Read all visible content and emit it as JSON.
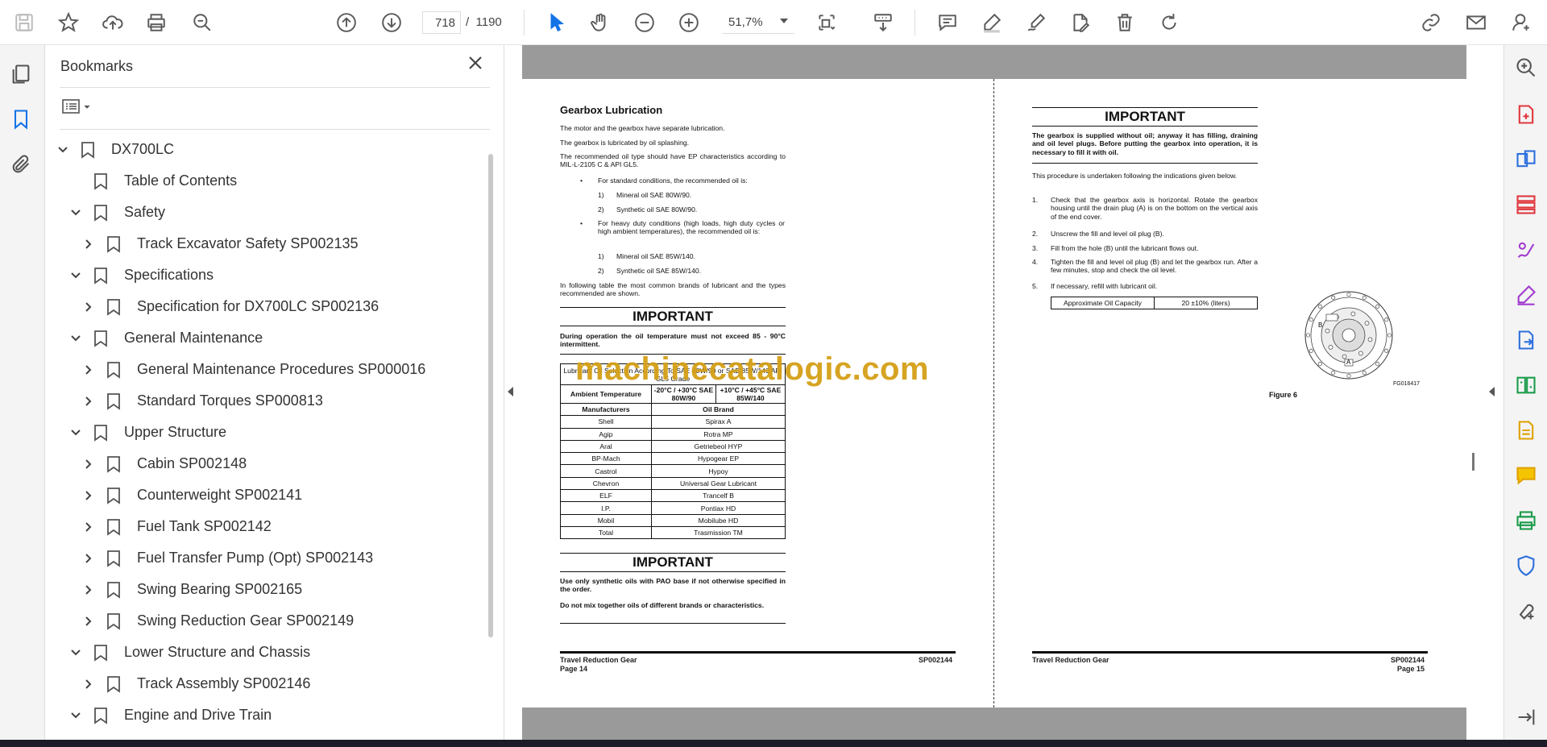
{
  "toolbar": {
    "current_page": "718",
    "separator": "/",
    "total_pages": "1190",
    "zoom": "51,7%"
  },
  "bookmarks": {
    "title": "Bookmarks",
    "items": [
      {
        "label": "DX700LC",
        "level": 0,
        "state": "expanded"
      },
      {
        "label": "Table of Contents",
        "level": 1,
        "state": "leaf"
      },
      {
        "label": "Safety",
        "level": 1,
        "state": "expanded"
      },
      {
        "label": "Track Excavator Safety SP002135",
        "level": 2,
        "state": "collapsed"
      },
      {
        "label": "Specifications",
        "level": 1,
        "state": "expanded"
      },
      {
        "label": "Specification for DX700LC SP002136",
        "level": 2,
        "state": "collapsed"
      },
      {
        "label": "General Maintenance",
        "level": 1,
        "state": "expanded"
      },
      {
        "label": "General Maintenance Procedures SP000016",
        "level": 2,
        "state": "collapsed"
      },
      {
        "label": "Standard Torques SP000813",
        "level": 2,
        "state": "collapsed"
      },
      {
        "label": "Upper Structure",
        "level": 1,
        "state": "expanded"
      },
      {
        "label": "Cabin SP002148",
        "level": 2,
        "state": "collapsed"
      },
      {
        "label": "Counterweight SP002141",
        "level": 2,
        "state": "collapsed"
      },
      {
        "label": "Fuel Tank SP002142",
        "level": 2,
        "state": "collapsed"
      },
      {
        "label": "Fuel Transfer Pump (Opt) SP002143",
        "level": 2,
        "state": "collapsed"
      },
      {
        "label": "Swing Bearing SP002165",
        "level": 2,
        "state": "collapsed"
      },
      {
        "label": "Swing Reduction Gear SP002149",
        "level": 2,
        "state": "collapsed"
      },
      {
        "label": "Lower Structure and Chassis",
        "level": 1,
        "state": "expanded"
      },
      {
        "label": "Track Assembly SP002146",
        "level": 2,
        "state": "collapsed"
      },
      {
        "label": "Engine and Drive Train",
        "level": 1,
        "state": "expanded"
      }
    ]
  },
  "left_page": {
    "heading": "Gearbox Lubrication",
    "p1": "The motor and the gearbox have separate lubrication.",
    "p2": "The gearbox is lubricated by oil splashing.",
    "p3": "The recommended oil type should have EP characteristics according to MIL-L-2105 C & API GL5.",
    "bullet1": "For standard conditions, the recommended oil is:",
    "b1_items": [
      "Mineral oil SAE 80W/90.",
      "Synthetic oil SAE 80W/90."
    ],
    "bullet2": "For heavy duty conditions (high loads, high duty cycles or high ambient temperatures), the recommended oil is:",
    "b2_items": [
      "Mineral oil SAE 85W/140.",
      "Synthetic oil SAE 85W/140."
    ],
    "p4": "In following table the most common brands of lubricant and the types recommended are shown.",
    "important1_title": "IMPORTANT",
    "important1_text": "During operation the oil temperature must not exceed 85 - 90°C intermittent.",
    "table_head": "Lubricant Oil Selection According To SAE 80W/90 or SAE 85W/140 API GL5 Grade",
    "col_amb": "Ambient Temperature",
    "col_1": "-20°C / +30°C SAE 80W/90",
    "col_2": "+10°C / +45°C SAE 85W/140",
    "col_man": "Manufacturers",
    "col_brand": "Oil Brand",
    "rows": [
      [
        "Shell",
        "Spirax A"
      ],
      [
        "Agip",
        "Rotra MP"
      ],
      [
        "Aral",
        "Getriebeol HYP"
      ],
      [
        "BP-Mach",
        "Hypogear EP"
      ],
      [
        "Castrol",
        "Hypoy"
      ],
      [
        "Chevron",
        "Universal Gear Lubricant"
      ],
      [
        "ELF",
        "Trancelf B"
      ],
      [
        "I.P.",
        "Pontiax HD"
      ],
      [
        "Mobil",
        "Mobilube HD"
      ],
      [
        "Total",
        "Trasmission TM"
      ]
    ],
    "important2_title": "IMPORTANT",
    "important2_text1": "Use only synthetic oils with PAO base if not otherwise specified in the order.",
    "important2_text2": "Do not mix together oils of different brands or characteristics.",
    "footer_left": "Travel Reduction Gear",
    "footer_page": "Page 14",
    "footer_code": "SP002144"
  },
  "right_page": {
    "important_title": "IMPORTANT",
    "important_text": "The gearbox is supplied without oil; anyway it has filling, draining and oil level plugs. Before putting the gearbox into operation, it is necessary to fill it with oil.",
    "intro": "This procedure is undertaken following the indications given below.",
    "steps": [
      "Check that the gearbox axis is horizontal. Rotate the gearbox housing until the drain plug (A) is on the bottom on the vertical axis of the end cover.",
      "Unscrew the fill and level oil plug (B).",
      "Fill from the hole (B) until the lubricant flows out.",
      "Tighten the fill and level oil plug (B) and let the gearbox run. After a few minutes, stop and check the oil level.",
      "If necessary, refill with lubricant oil."
    ],
    "capacity_label": "Approximate Oil Capacity",
    "capacity_value": "20 ±10% (liters)",
    "figure_code": "FG016417",
    "figure_caption": "Figure 6",
    "label_a": "A",
    "label_b": "B",
    "footer_left": "Travel Reduction Gear",
    "footer_code": "SP002144",
    "footer_page": "Page 15"
  },
  "watermark": "machinecatalogic.com"
}
